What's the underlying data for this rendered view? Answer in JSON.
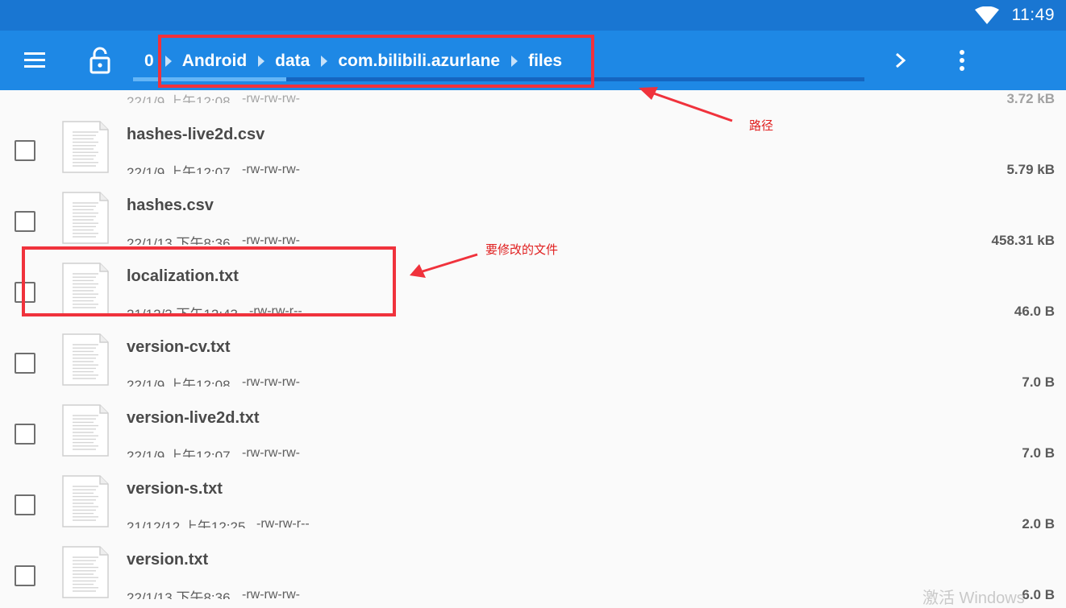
{
  "status_bar": {
    "time": "11:49"
  },
  "toolbar": {
    "breadcrumbs": [
      "0",
      "Android",
      "data",
      "com.bilibili.azurlane",
      "files"
    ],
    "progress_fraction": 0.21
  },
  "files": [
    {
      "name": "",
      "date": "22/1/9 上午12:08",
      "perm": "-rw-rw-rw-",
      "size": "3.72 kB"
    },
    {
      "name": "hashes-live2d.csv",
      "date": "22/1/9 上午12:07",
      "perm": "-rw-rw-rw-",
      "size": "5.79 kB"
    },
    {
      "name": "hashes.csv",
      "date": "22/1/13 下午8:36",
      "perm": "-rw-rw-rw-",
      "size": "458.31 kB"
    },
    {
      "name": "localization.txt",
      "date": "21/12/3 下午12:43",
      "perm": "-rw-rw-r--",
      "size": "46.0 B"
    },
    {
      "name": "version-cv.txt",
      "date": "22/1/9 上午12:08",
      "perm": "-rw-rw-rw-",
      "size": "7.0 B"
    },
    {
      "name": "version-live2d.txt",
      "date": "22/1/9 上午12:07",
      "perm": "-rw-rw-rw-",
      "size": "7.0 B"
    },
    {
      "name": "version-s.txt",
      "date": "21/12/12 上午12:25",
      "perm": "-rw-rw-r--",
      "size": "2.0 B"
    },
    {
      "name": "version.txt",
      "date": "22/1/13 下午8:36",
      "perm": "-rw-rw-rw-",
      "size": "6.0 B"
    }
  ],
  "annotations": {
    "path_note": "路径",
    "file_note": "要修改的文件",
    "color": "#f0323c"
  },
  "watermark": "激活 Windows",
  "colors": {
    "status_bar": "#1976d2",
    "toolbar": "#1e88e5",
    "progress_track": "#1565c0",
    "progress_fill": "#64b5f6"
  }
}
